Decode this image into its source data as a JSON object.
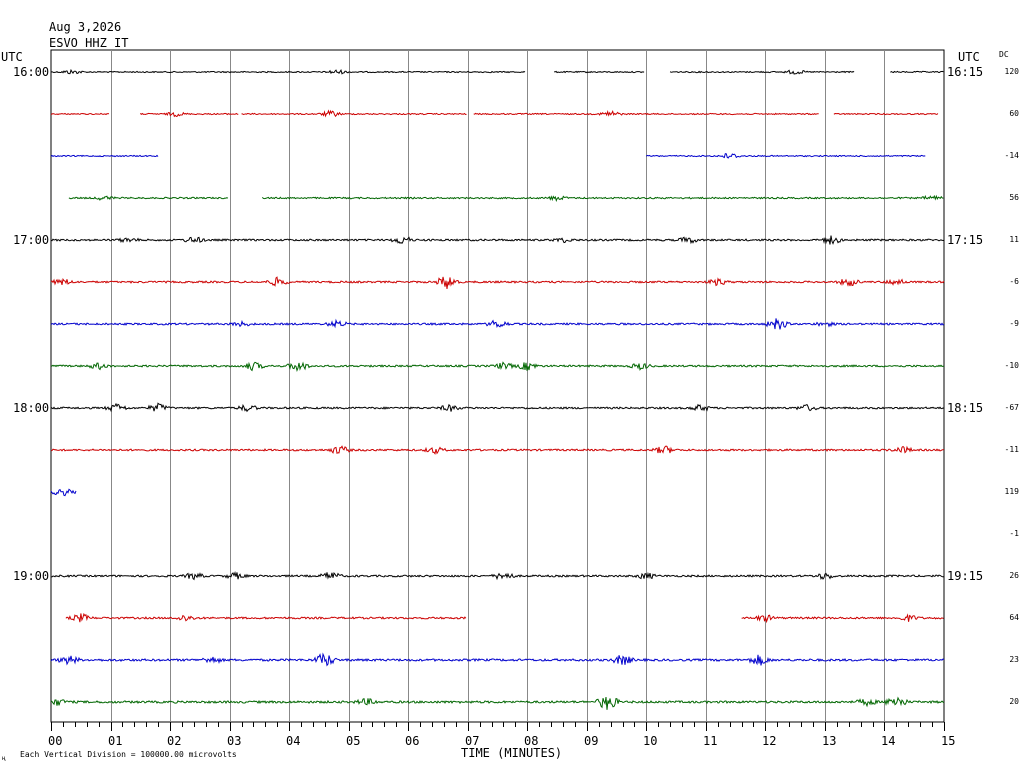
{
  "header": {
    "date": "Aug 3,2026",
    "station": "ESVO HHZ IT",
    "utc_left": "UTC",
    "utc_right": "UTC",
    "dc_label": "DC"
  },
  "footer": {
    "scale_note": "Each Vertical Division = 100000.00 microvolts",
    "mark": "ң"
  },
  "chart_data": {
    "type": "line",
    "title": "",
    "xlabel": "TIME (MINUTES)",
    "ylabel": "",
    "xlim": [
      0,
      15
    ],
    "x_ticks": [
      "00",
      "01",
      "02",
      "03",
      "04",
      "05",
      "06",
      "07",
      "08",
      "09",
      "10",
      "11",
      "12",
      "13",
      "14",
      "15"
    ],
    "grid": "vertical lines every minute",
    "trace_colors": [
      "#000000",
      "#cc0000",
      "#0000cc",
      "#006600"
    ],
    "hour_labels_left": [
      "16:00",
      "17:00",
      "18:00",
      "19:00"
    ],
    "hour_labels_right": [
      "16:15",
      "17:15",
      "18:15",
      "19:15"
    ],
    "rows": [
      {
        "row": 0,
        "dc": "120",
        "segments": [
          [
            0.0,
            7.97
          ],
          [
            8.45,
            9.97
          ],
          [
            10.4,
            13.5
          ],
          [
            14.1,
            15.0
          ]
        ],
        "noise": 1.0,
        "bursts": [
          [
            0.35,
            2
          ],
          [
            4.8,
            2
          ],
          [
            12.5,
            2
          ]
        ]
      },
      {
        "row": 1,
        "dc": "60",
        "segments": [
          [
            0.0,
            0.98
          ],
          [
            1.5,
            3.15
          ],
          [
            3.2,
            6.98
          ],
          [
            7.1,
            12.9
          ],
          [
            13.15,
            14.9
          ]
        ],
        "noise": 1.0,
        "bursts": [
          [
            2.1,
            2
          ],
          [
            4.7,
            3
          ],
          [
            9.4,
            3
          ]
        ]
      },
      {
        "row": 2,
        "dc": "-14",
        "segments": [
          [
            0.0,
            1.8
          ],
          [
            10.0,
            14.7
          ]
        ],
        "noise": 1.0,
        "bursts": [
          [
            11.4,
            3
          ]
        ]
      },
      {
        "row": 3,
        "dc": "56",
        "segments": [
          [
            0.3,
            2.98
          ],
          [
            3.55,
            15.0
          ]
        ],
        "noise": 1.2,
        "bursts": [
          [
            0.9,
            2
          ],
          [
            8.5,
            2
          ],
          [
            14.8,
            2
          ]
        ]
      },
      {
        "row": 4,
        "dc": "11",
        "segments": [
          [
            0.0,
            15.0
          ]
        ],
        "noise": 1.5,
        "bursts": [
          [
            1.3,
            2
          ],
          [
            2.4,
            3
          ],
          [
            5.9,
            4
          ],
          [
            8.6,
            2
          ],
          [
            10.7,
            3
          ],
          [
            13.1,
            4
          ]
        ]
      },
      {
        "row": 5,
        "dc": "-6",
        "segments": [
          [
            0.0,
            15.0
          ]
        ],
        "noise": 1.5,
        "bursts": [
          [
            0.2,
            3
          ],
          [
            3.8,
            4
          ],
          [
            6.65,
            7
          ],
          [
            11.2,
            3
          ],
          [
            13.4,
            4
          ],
          [
            14.2,
            3
          ]
        ]
      },
      {
        "row": 6,
        "dc": "-9",
        "segments": [
          [
            0.0,
            15.0
          ]
        ],
        "noise": 1.5,
        "bursts": [
          [
            3.2,
            2
          ],
          [
            4.8,
            3
          ],
          [
            7.5,
            4
          ],
          [
            12.2,
            6
          ],
          [
            13.0,
            2
          ]
        ]
      },
      {
        "row": 7,
        "dc": "-10",
        "segments": [
          [
            0.0,
            15.0
          ]
        ],
        "noise": 1.5,
        "bursts": [
          [
            0.8,
            3
          ],
          [
            3.4,
            4
          ],
          [
            4.15,
            5
          ],
          [
            7.6,
            3
          ],
          [
            8.0,
            4
          ],
          [
            9.9,
            3
          ]
        ]
      },
      {
        "row": 8,
        "dc": "-67",
        "segments": [
          [
            0.0,
            15.0
          ]
        ],
        "noise": 1.5,
        "bursts": [
          [
            1.1,
            4
          ],
          [
            1.8,
            4
          ],
          [
            3.3,
            3
          ],
          [
            6.7,
            3
          ],
          [
            10.9,
            3
          ],
          [
            12.7,
            3
          ]
        ]
      },
      {
        "row": 9,
        "dc": "-11",
        "segments": [
          [
            0.0,
            15.0
          ]
        ],
        "noise": 1.5,
        "bursts": [
          [
            4.85,
            4
          ],
          [
            6.45,
            3
          ],
          [
            10.3,
            4
          ],
          [
            14.3,
            3
          ]
        ]
      },
      {
        "row": 10,
        "dc": "119",
        "segments": [
          [
            0.0,
            0.42
          ]
        ],
        "noise": 2.0,
        "bursts": [
          [
            0.2,
            3
          ]
        ]
      },
      {
        "row": 11,
        "dc": "-1",
        "segments": [],
        "noise": 0,
        "bursts": []
      },
      {
        "row": 12,
        "dc": "26",
        "segments": [
          [
            0.0,
            15.0
          ]
        ],
        "noise": 1.5,
        "bursts": [
          [
            2.4,
            3
          ],
          [
            3.1,
            3
          ],
          [
            4.7,
            4
          ],
          [
            7.6,
            4
          ],
          [
            10.0,
            3
          ],
          [
            13.0,
            3
          ]
        ]
      },
      {
        "row": 13,
        "dc": "64",
        "segments": [
          [
            0.25,
            6.98
          ],
          [
            11.6,
            15.0
          ]
        ],
        "noise": 1.5,
        "bursts": [
          [
            0.5,
            4
          ],
          [
            2.25,
            3
          ],
          [
            12.0,
            3
          ],
          [
            14.4,
            3
          ]
        ]
      },
      {
        "row": 14,
        "dc": "23",
        "segments": [
          [
            0.0,
            15.0
          ]
        ],
        "noise": 1.8,
        "bursts": [
          [
            0.3,
            4
          ],
          [
            2.7,
            3
          ],
          [
            4.6,
            7
          ],
          [
            9.6,
            5
          ],
          [
            11.9,
            5
          ]
        ]
      },
      {
        "row": 15,
        "dc": "20",
        "segments": [
          [
            0.0,
            15.0
          ]
        ],
        "noise": 1.8,
        "bursts": [
          [
            0.1,
            3
          ],
          [
            5.3,
            3
          ],
          [
            9.35,
            8
          ],
          [
            13.7,
            3
          ],
          [
            14.2,
            6
          ]
        ]
      }
    ]
  }
}
